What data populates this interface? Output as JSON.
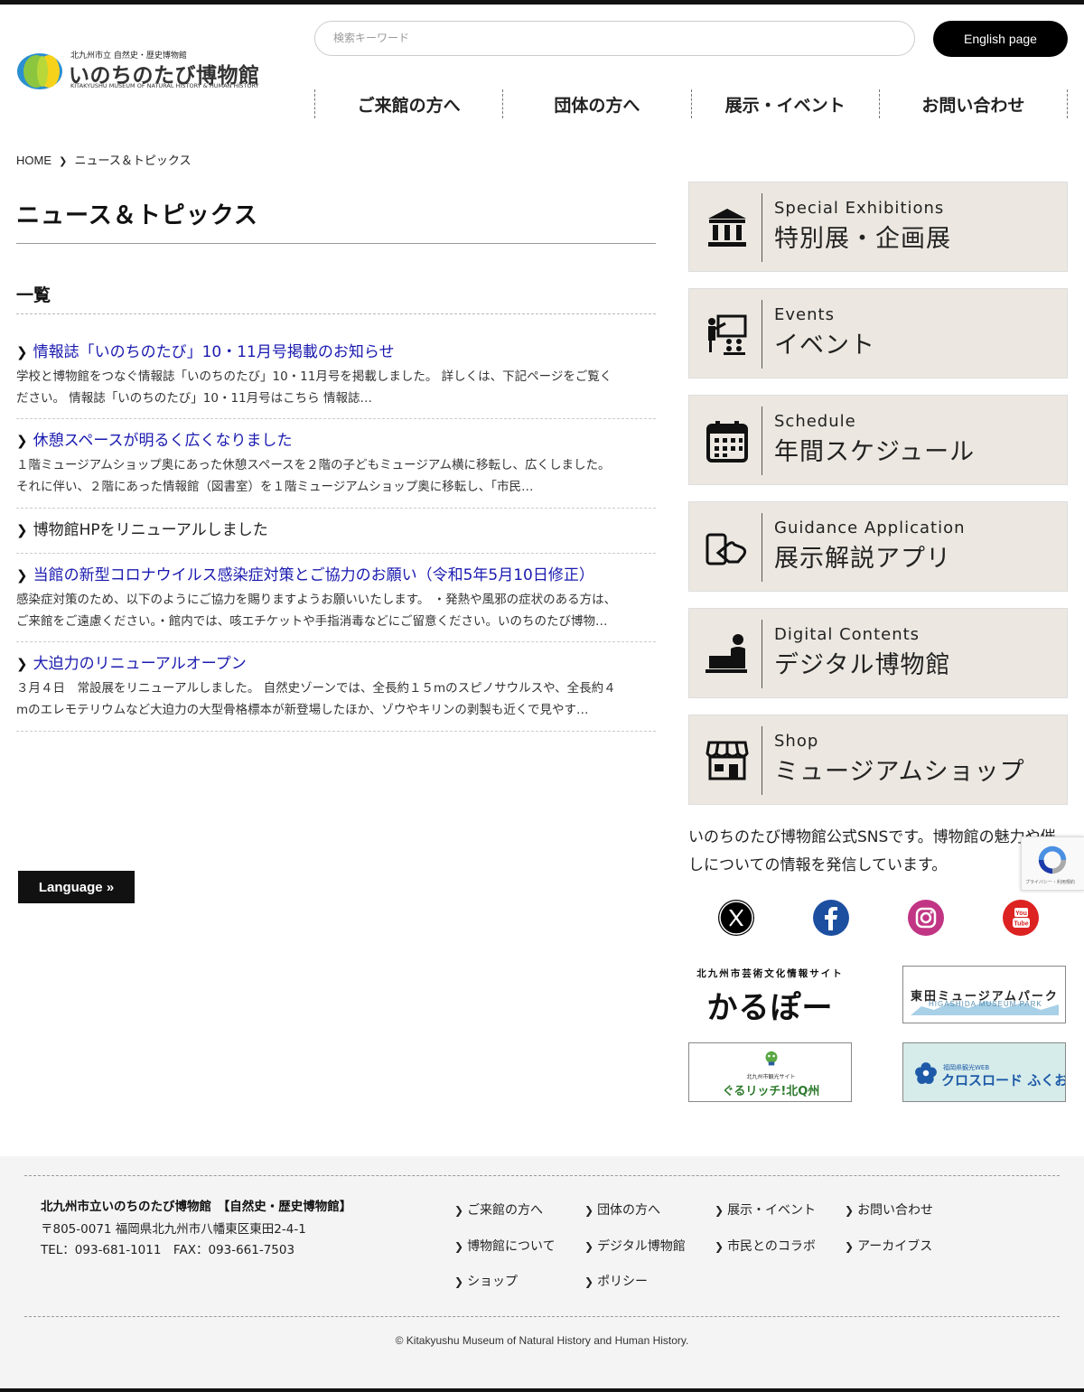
{
  "header": {
    "logo": {
      "subtitle": "北九州市立 自然史・歴史博物館",
      "name": "いのちのたび博物館",
      "english": "KITAKYUSHU MUSEUM OF NATURAL HISTORY & HUMAN HISTORY"
    },
    "search": {
      "placeholder": "検索キーワード",
      "value": ""
    },
    "english_button": "English page",
    "nav": [
      "ご来館の方へ",
      "団体の方へ",
      "展示・イベント",
      "お問い合わせ"
    ]
  },
  "breadcrumb": {
    "home": "HOME",
    "separator": "❯",
    "current": "ニュース＆トピックス"
  },
  "main": {
    "page_title": "ニュース＆トピックス",
    "list_heading": "一覧",
    "news": [
      {
        "title": "情報誌「いのちのたび」10・11月号掲載のお知らせ",
        "excerpt_lines": [
          "学校と博物館をつなぐ情報誌「いのちのたび」10・11月号を掲載しました。 詳しくは、下記ページをご覧く",
          "ださい。 情報誌「いのちのたび」10・11月号はこちら 情報誌…"
        ]
      },
      {
        "title": "休憩スペースが明るく広くなりました",
        "excerpt_lines": [
          "１階ミュージアムショップ奥にあった休憩スペースを２階の子どもミュージアム横に移転し、広くしました。",
          "それに伴い、２階にあった情報館（図書室）を１階ミュージアムショップ奥に移転し、「市民…"
        ]
      },
      {
        "title": "博物館HPをリニューアルしました",
        "excerpt_lines": []
      },
      {
        "title": "当館の新型コロナウイルス感染症対策とご協力のお願い（令和5年5月10日修正）",
        "excerpt_lines": [
          "感染症対策のため、以下のようにご協力を賜りますようお願いいたします。 ・発熱や風邪の症状のある方は、",
          "ご来館をご遠慮ください。・館内では、咳エチケットや手指消毒などにご留意ください。いのちのたび博物…"
        ]
      },
      {
        "title": "大迫力のリニューアルオープン",
        "excerpt_lines": [
          "３月４日　常設展をリニューアルしました。 自然史ゾーンでは、全長約１５mのスピノサウルスや、全長約４",
          "mのエレモテリウムなど大迫力の大型骨格標本が新登場したほか、ゾウやキリンの剥製も近くで見やす…"
        ]
      }
    ],
    "language_button": "Language »"
  },
  "sidebar": {
    "buttons": [
      {
        "en": "Special Exhibitions",
        "jp": "特別展・企画展",
        "icon": "museum-icon"
      },
      {
        "en": "Events",
        "jp": "イベント",
        "icon": "presentation-icon"
      },
      {
        "en": "Schedule",
        "jp": "年間スケジュール",
        "icon": "calendar-icon"
      },
      {
        "en": "Guidance Application",
        "jp": "展示解説アプリ",
        "icon": "smartphone-hand-icon"
      },
      {
        "en": "Digital Contents",
        "jp": "デジタル博物館",
        "icon": "laptop-user-icon"
      },
      {
        "en": "Shop",
        "jp": "ミュージアムショップ",
        "icon": "shop-icon"
      }
    ],
    "sns_text": "いのちのたび博物館公式SNSです。博物館の魅力や催しについての情報を発信しています。",
    "sns": [
      "x-icon",
      "facebook-icon",
      "instagram-icon",
      "youtube-icon"
    ],
    "banners": [
      {
        "caption": "北九州市芸術文化情報サイト",
        "title": "かるぽー"
      },
      {
        "title": "東田ミュージアムパーク",
        "caption": "HIGASHIDA MUSEUM PARK"
      },
      {
        "caption": "北九州市観光サイト",
        "title": "ぐるリッチ!北Q州"
      },
      {
        "caption": "福岡県観光WEB",
        "title": "クロスロード ふくおか"
      }
    ],
    "recaptcha_text": "プライバシー・利用規約"
  },
  "footer": {
    "name": "北九州市立いのちのたび博物館　【自然史・歴史博物館】",
    "address": "〒805-0071 福岡県北九州市八幡東区東田2-4-1",
    "tel": "TEL：093-681-1011　FAX：093-661-7503",
    "links": [
      "ご来館の方へ",
      "団体の方へ",
      "展示・イベント",
      "お問い合わせ",
      "博物館について",
      "デジタル博物館",
      "市民とのコラボ",
      "アーカイブス",
      "ショップ",
      "ポリシー"
    ],
    "copyright": "© Kitakyushu Museum of Natural History and Human History."
  },
  "colors": {
    "link": "#1a1ab0",
    "sidebar_bg": "#ece8e1",
    "footer_bg": "#f4f4f4"
  }
}
